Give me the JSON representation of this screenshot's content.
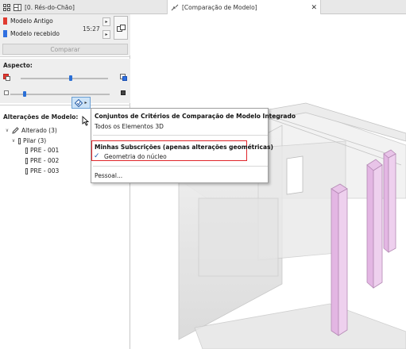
{
  "tabs": [
    {
      "label": "[0. Rés-do-Chão]",
      "icon": "floor-plan-icon"
    },
    {
      "label": "[Comparação de Modelo]",
      "icon": "model-compare-icon",
      "close": "✕"
    }
  ],
  "panel": {
    "models": [
      {
        "name": "Modelo Antigo",
        "color": "#e03a2f"
      },
      {
        "name": "Modelo recebido",
        "color": "#2f6fe0",
        "time": "15:27"
      }
    ],
    "compare_label": "Comparar",
    "aspect_title": "Aspecto:",
    "sliders": [
      {
        "level": 0.57
      },
      {
        "level": 0.14
      }
    ],
    "changes_title": "Alterações de Modelo:",
    "tree": [
      {
        "label": "Alterado (3)",
        "level": 0,
        "icon": "pencil-icon"
      },
      {
        "label": "Pilar (3)",
        "level": 1,
        "icon": "pillar-icon"
      },
      {
        "label": "PRE - 001",
        "level": 2,
        "icon": "pillar-icon"
      },
      {
        "label": "PRE - 002",
        "level": 2,
        "icon": "pillar-icon"
      },
      {
        "label": "PRE - 003",
        "level": 2,
        "icon": "pillar-icon"
      }
    ]
  },
  "menu": {
    "integrated_header": "Conjuntos de Critérios de Comparação de Modelo Integrado",
    "all_elements": "Todos os Elementos 3D",
    "subscriptions_header": "Minhas Subscrições (apenas alterações geométricas)",
    "core_geometry": "Geometria do núcleo",
    "core_geometry_checked": true,
    "custom": "Pessoal..."
  },
  "colors": {
    "changed_element": "#e8c4e8",
    "highlight": "#e0262b",
    "accent": "#2a6fd6"
  }
}
